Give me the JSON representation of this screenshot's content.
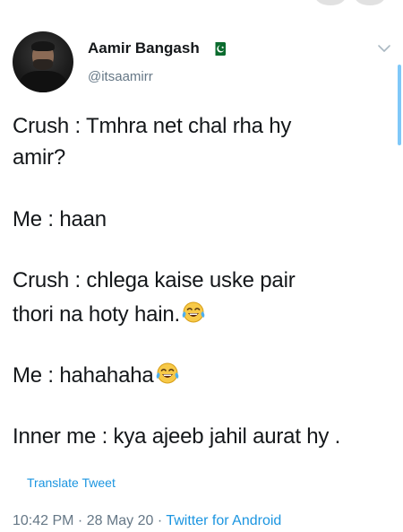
{
  "author": {
    "name": "Aamir Bangash",
    "handle": "@itsaamirr"
  },
  "tweet": {
    "lines": [
      "Crush : Tmhra net chal rha hy",
      "amir?",
      "Me : haan",
      "Crush : chlega kaise uske pair",
      "thori na hoty hain.",
      "Me : hahahaha",
      "Inner me : kya ajeeb jahil aurat hy ."
    ]
  },
  "translate_label": "Translate Tweet",
  "meta": {
    "time": "10:42 PM",
    "separator": " · ",
    "date": "28 May 20",
    "source": "Twitter for Android"
  },
  "icons": {
    "flag": "pakistan-flag-icon",
    "menu": "chevron-down-icon",
    "emoji": "face-with-tears-of-joy-icon"
  },
  "colors": {
    "text": "#14171a",
    "secondary": "#657786",
    "link": "#1b95e0"
  }
}
